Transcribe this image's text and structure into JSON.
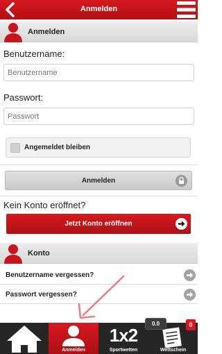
{
  "header": {
    "title": "Anmelden"
  },
  "login_section": {
    "title": "Anmelden"
  },
  "form": {
    "username_label": "Benutzername:",
    "username_placeholder": "Benutzername",
    "password_label": "Passwort:",
    "password_placeholder": "Passwort",
    "remember_label": "Angemeldet bleiben",
    "remember_checked": false,
    "submit_label": "Anmelden"
  },
  "register": {
    "prompt": "Kein Konto eröffnet?",
    "button_label": "Jetzt Konto eröffnen"
  },
  "account_section": {
    "title": "Konto",
    "links": [
      {
        "label": "Benutzername vergessen?"
      },
      {
        "label": "Passwort vergessen?"
      }
    ]
  },
  "tabbar": {
    "tabs": [
      {
        "label": "",
        "icon": "home-icon"
      },
      {
        "label": "Anmelden",
        "icon": "user-icon",
        "active": true
      },
      {
        "label": "Sportwetten",
        "icon": "1x2",
        "glyph": "1x2"
      },
      {
        "label": "Wettschein",
        "icon": "bet-slip-icon"
      }
    ],
    "bet_amount": "0.0",
    "bet_count": "0"
  },
  "colors": {
    "brand_red": "#c8141a",
    "tabbar_bg": "#262626",
    "pointer_arrow": "#f07c7c"
  }
}
